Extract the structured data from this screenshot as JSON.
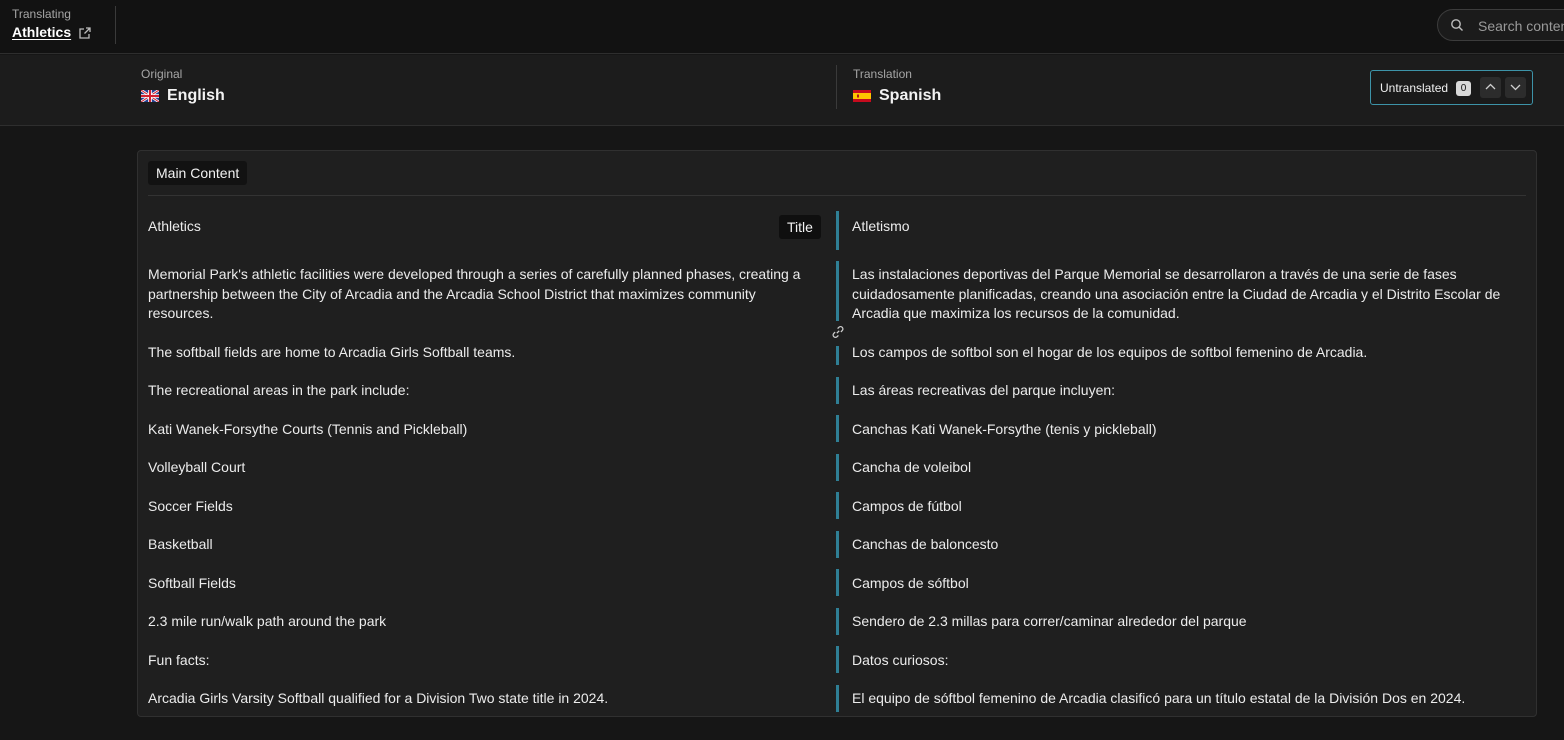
{
  "topbar": {
    "translating_label": "Translating",
    "document_title": "Athletics",
    "search_placeholder": "Search content"
  },
  "languages": {
    "original_label": "Original",
    "original_name": "English",
    "translation_label": "Translation",
    "translation_name": "Spanish"
  },
  "filter": {
    "label": "Untranslated",
    "count": "0"
  },
  "card": {
    "section_label": "Main Content",
    "title_badge": "Title",
    "rows": [
      {
        "source": "Athletics",
        "target": "Atletismo"
      },
      {
        "source": "Memorial Park's athletic facilities were developed through a series of carefully planned phases, creating a partnership between the City of Arcadia and the Arcadia School District that maximizes community resources.",
        "target": "Las instalaciones deportivas del Parque Memorial se desarrollaron a través de una serie de fases cuidadosamente planificadas, creando una asociación entre la Ciudad de Arcadia y el Distrito Escolar de Arcadia que maximiza los recursos de la comunidad."
      },
      {
        "source": "The softball fields are home to Arcadia Girls Softball teams.",
        "target": "Los campos de softbol son el hogar de los equipos de softbol femenino de Arcadia."
      },
      {
        "source": "The recreational areas in the park include:",
        "target": "Las áreas recreativas del parque incluyen:"
      },
      {
        "source": "Kati Wanek-Forsythe Courts (Tennis and Pickleball)",
        "target": "Canchas Kati Wanek-Forsythe (tenis y pickleball)"
      },
      {
        "source": "Volleyball Court",
        "target": "Cancha de voleibol"
      },
      {
        "source": "Soccer Fields",
        "target": "Campos de fútbol"
      },
      {
        "source": "Basketball",
        "target": "Canchas de baloncesto"
      },
      {
        "source": "Softball Fields",
        "target": "Campos de sóftbol"
      },
      {
        "source": "2.3 mile run/walk path around the park",
        "target": "Sendero de 2.3 millas para correr/caminar alrededor del parque"
      },
      {
        "source": "Fun facts:",
        "target": "Datos curiosos:"
      },
      {
        "source": "Arcadia Girls Varsity Softball qualified for a Division Two state title in 2024.",
        "target": "El equipo de sóftbol femenino de Arcadia clasificó para un título estatal de la División Dos en 2024."
      }
    ]
  },
  "icons": {
    "external_link": "external-link-icon",
    "search": "search-icon",
    "flag_original": "uk-flag-icon",
    "flag_translation": "spain-flag-icon",
    "nav_up": "chevron-up-icon",
    "nav_down": "chevron-down-icon",
    "link": "link-icon"
  },
  "colors": {
    "accent": "#2f7f95",
    "filter_border": "#3d93a8",
    "background": "#161616",
    "card": "#1f1f1f"
  }
}
